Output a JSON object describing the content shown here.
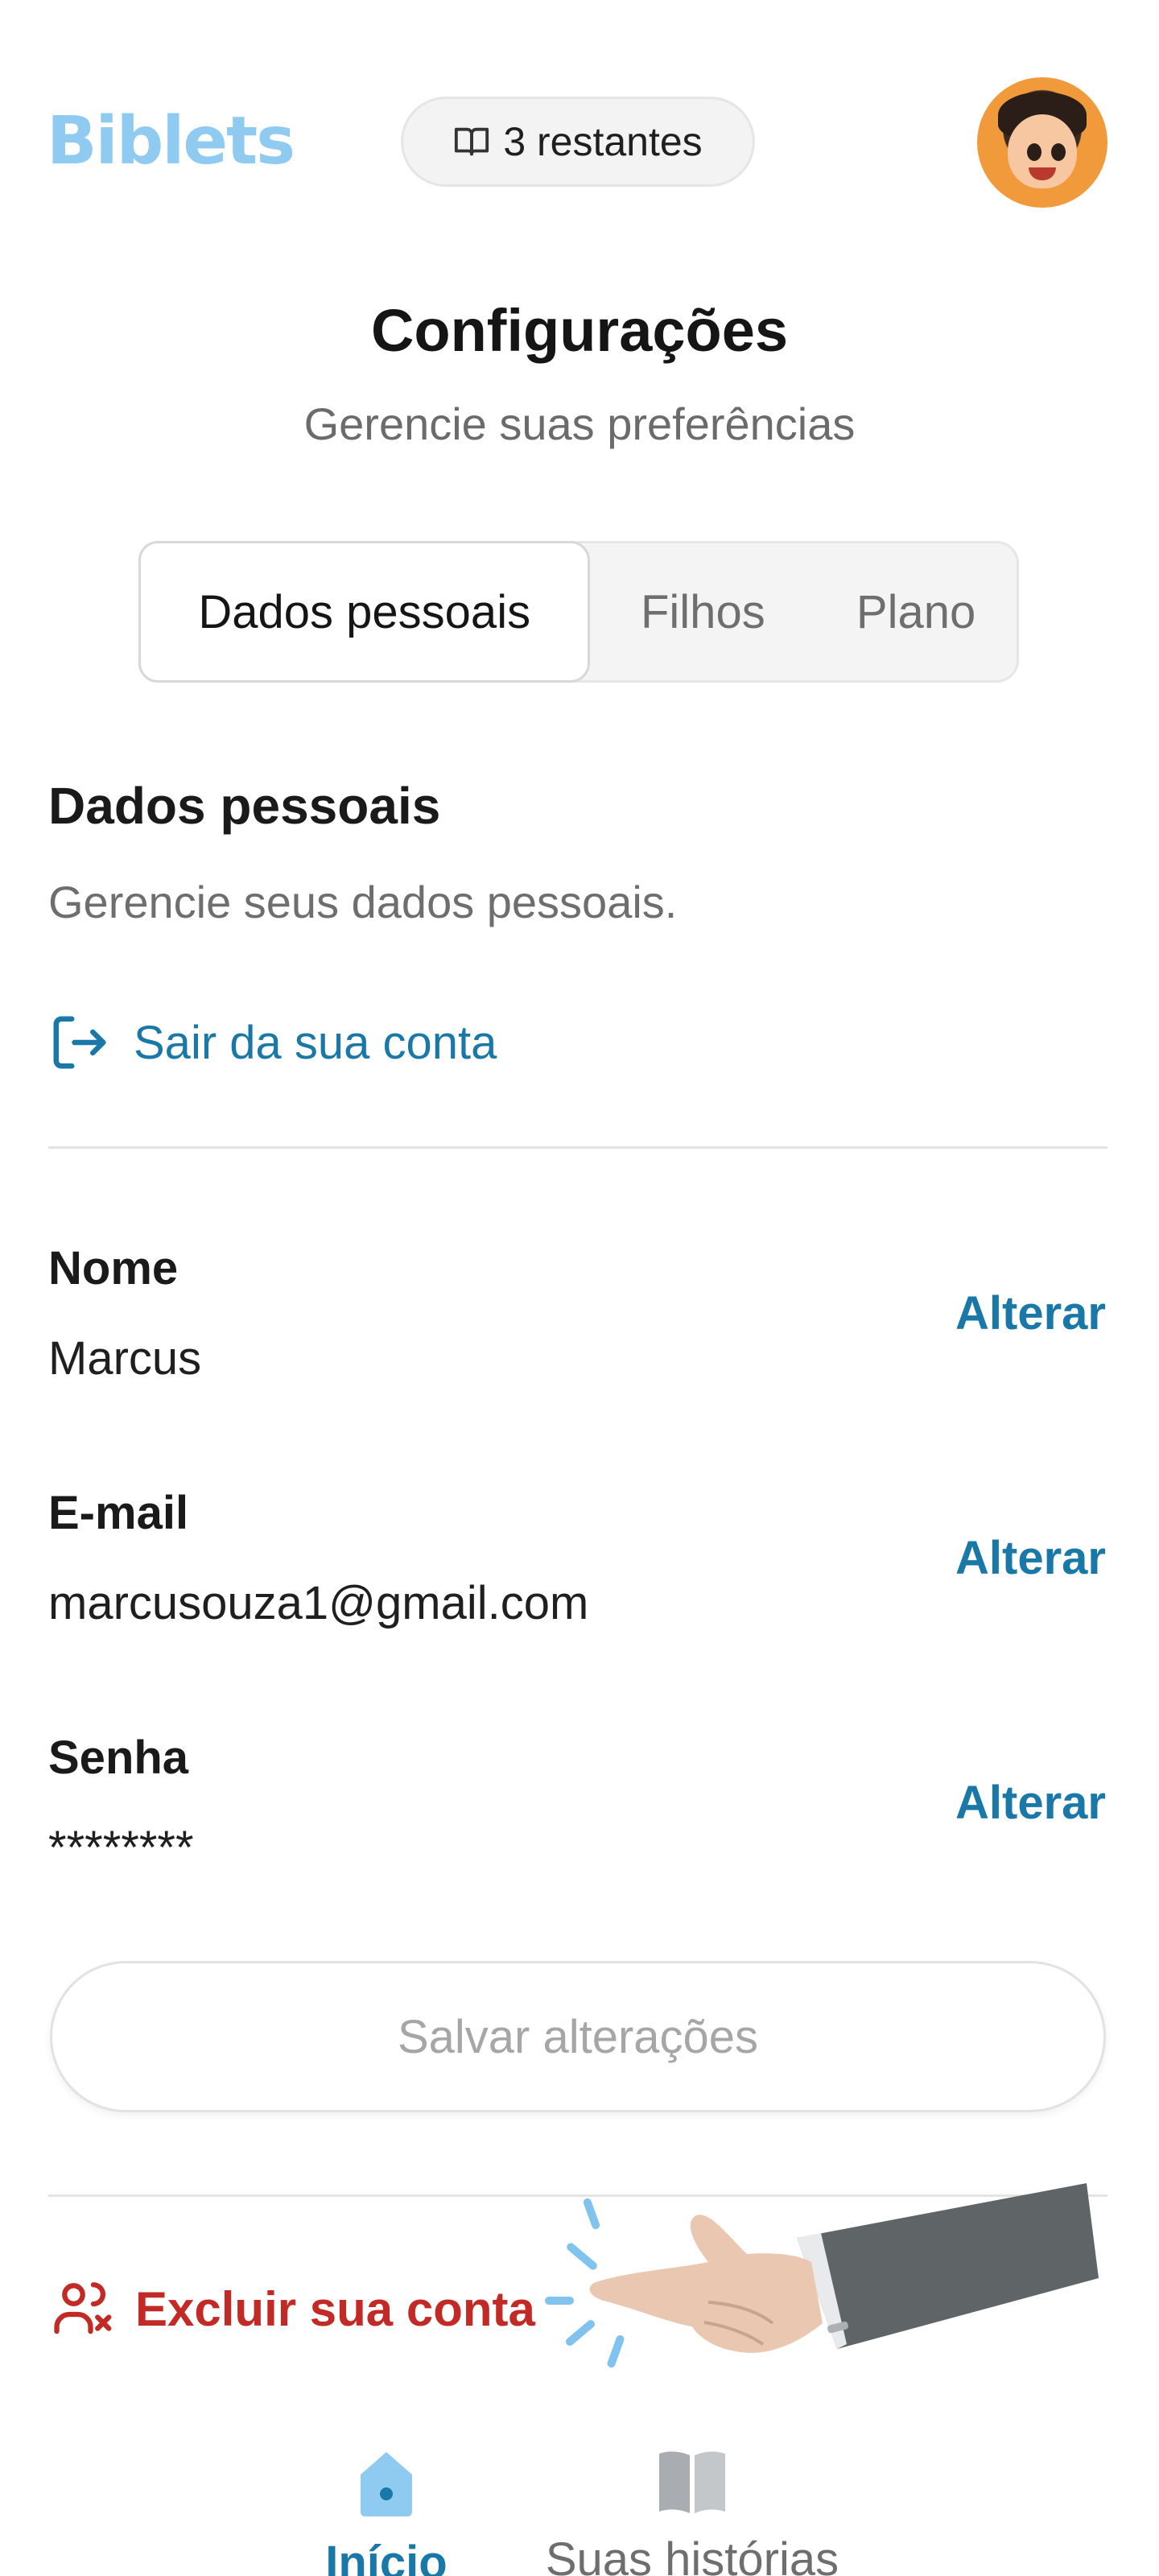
{
  "header": {
    "logo_text": "Biblets",
    "credits_label": "3 restantes"
  },
  "page": {
    "title": "Configurações",
    "subtitle": "Gerencie suas preferências"
  },
  "tabs": [
    {
      "label": "Dados pessoais",
      "active": true
    },
    {
      "label": "Filhos",
      "active": false
    },
    {
      "label": "Plano",
      "active": false
    }
  ],
  "section": {
    "title": "Dados pessoais",
    "description": "Gerencie seus dados pessoais.",
    "logout_label": "Sair da sua conta"
  },
  "fields": [
    {
      "label": "Nome",
      "value": "Marcus",
      "action": "Alterar"
    },
    {
      "label": "E-mail",
      "value": "marcusouza1@gmail.com",
      "action": "Alterar"
    },
    {
      "label": "Senha",
      "value": "********",
      "action": "Alterar"
    }
  ],
  "save_label": "Salvar alterações",
  "delete_label": "Excluir sua conta",
  "bottom_nav": [
    {
      "label": "Início",
      "icon": "home-icon",
      "active": true
    },
    {
      "label": "Suas histórias",
      "icon": "book-icon",
      "active": false
    }
  ],
  "colors": {
    "accent": "#1a78a8",
    "logo": "#8fcaf0",
    "danger": "#c22b25",
    "muted": "#6e6e6e"
  }
}
